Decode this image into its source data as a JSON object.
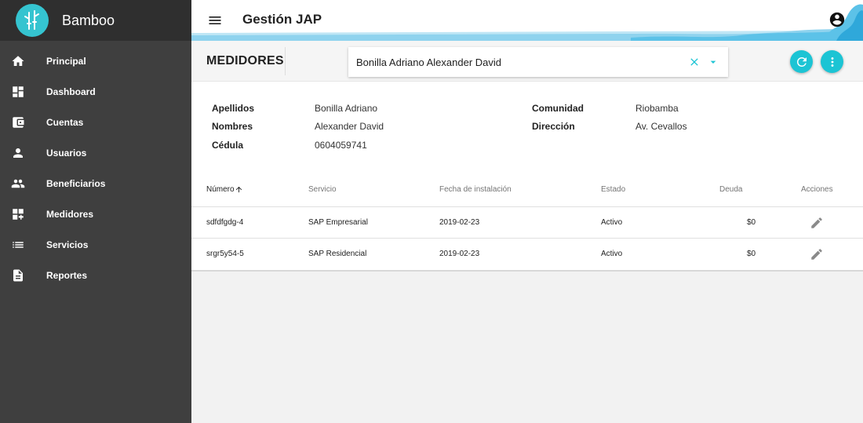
{
  "sidebar": {
    "brand": "Bamboo",
    "items": [
      {
        "label": "Principal",
        "icon": "home-icon"
      },
      {
        "label": "Dashboard",
        "icon": "dashboard-icon"
      },
      {
        "label": "Cuentas",
        "icon": "wallet-icon"
      },
      {
        "label": "Usuarios",
        "icon": "person-icon"
      },
      {
        "label": "Beneficiarios",
        "icon": "people-icon"
      },
      {
        "label": "Medidores",
        "icon": "meters-icon"
      },
      {
        "label": "Servicios",
        "icon": "list-icon"
      },
      {
        "label": "Reportes",
        "icon": "document-icon"
      }
    ]
  },
  "topbar": {
    "title": "Gestión JAP"
  },
  "header": {
    "section_title": "MEDIDORES",
    "search_value": "Bonilla Adriano Alexander David"
  },
  "details": {
    "apellidos_label": "Apellidos",
    "apellidos_value": "Bonilla Adriano",
    "nombres_label": "Nombres",
    "nombres_value": "Alexander David",
    "cedula_label": "Cédula",
    "cedula_value": "0604059741",
    "comunidad_label": "Comunidad",
    "comunidad_value": "Riobamba",
    "direccion_label": "Dirección",
    "direccion_value": "Av. Cevallos"
  },
  "table": {
    "headers": {
      "numero": "Número",
      "servicio": "Servicio",
      "fecha": "Fecha de instalación",
      "estado": "Estado",
      "deuda": "Deuda",
      "acciones": "Acciones"
    },
    "rows": [
      {
        "numero": "sdfdfgdg-4",
        "servicio": "SAP Empresarial",
        "fecha": "2019-02-23",
        "estado": "Activo",
        "deuda": "$0"
      },
      {
        "numero": "srgr5y54-5",
        "servicio": "SAP Residencial",
        "fecha": "2019-02-23",
        "estado": "Activo",
        "deuda": "$0"
      }
    ]
  },
  "colors": {
    "accent": "#1cc4d4",
    "sidebar_bg": "#3f3f3f",
    "brand_bg": "#2f2f2f"
  }
}
